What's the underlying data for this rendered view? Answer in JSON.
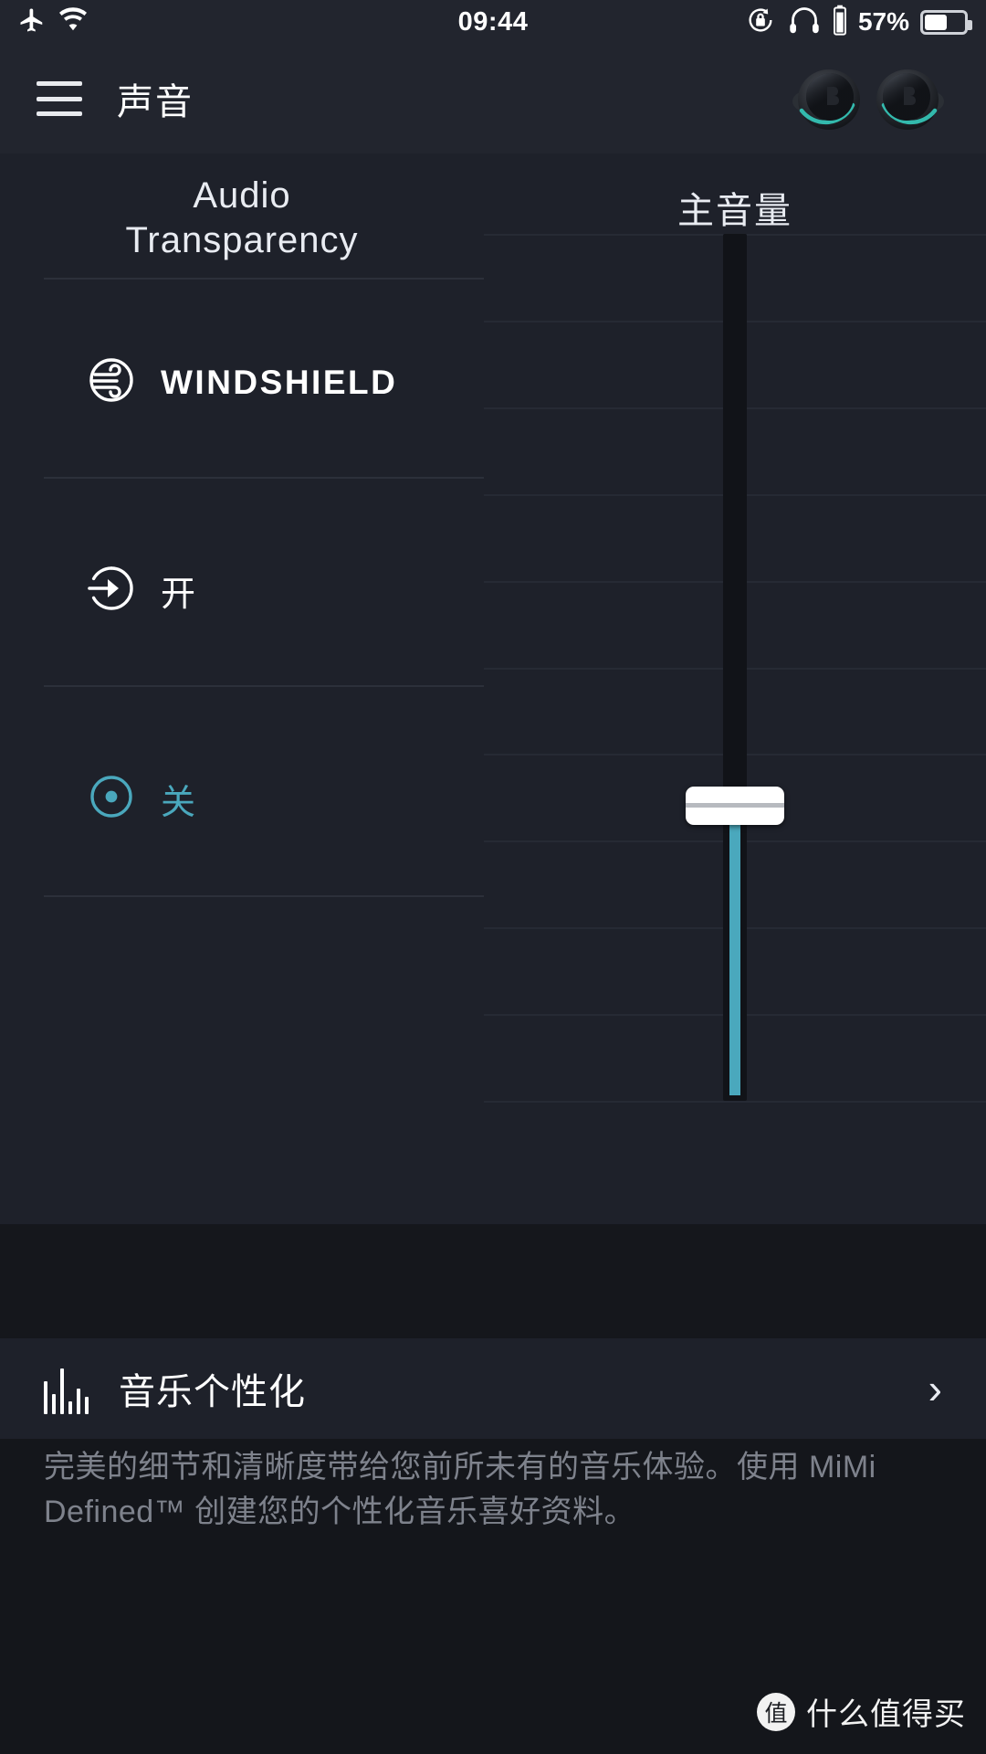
{
  "status_bar": {
    "airplane_icon": "airplane-mode-icon",
    "wifi_icon": "wifi-icon",
    "time": "09:44",
    "rotation_lock_icon": "rotation-lock-icon",
    "headphones_icon": "headphones-icon",
    "battery_small_icon": "battery-vertical-icon",
    "battery_percent": "57%",
    "battery_level": 57
  },
  "header": {
    "menu_icon": "hamburger-menu-icon",
    "title": "声音",
    "earbud_left_icon": "earbud-left-icon",
    "earbud_right_icon": "earbud-right-icon"
  },
  "audio_transparency": {
    "title_line1": "Audio",
    "title_line2": "Transparency",
    "options": [
      {
        "label": "WINDSHIELD",
        "icon": "wind-circle-icon",
        "selected": false,
        "style": "latin"
      },
      {
        "label": "开",
        "icon": "arrow-into-circle-icon",
        "selected": false,
        "style": "cjk"
      },
      {
        "label": "关",
        "icon": "radio-dot-icon",
        "selected": true,
        "style": "cjk"
      }
    ]
  },
  "volume": {
    "title": "主音量",
    "value_percent": 34,
    "gridline_count": 11
  },
  "music_personalization": {
    "icon": "equalizer-bars-icon",
    "title": "音乐个性化",
    "chevron_icon": "chevron-right-icon",
    "description": "完美的细节和清晰度带给您前所未有的音乐体验。使用 MiMi Defined™ 创建您的个性化音乐喜好资料。"
  },
  "watermark": {
    "logo_char": "值",
    "text": "什么值得买"
  },
  "colors": {
    "accent": "#4aa8bd",
    "page_bg": "#1e212a",
    "bar_bg": "#22252e",
    "band_bg": "#15171c",
    "text_primary": "#ffffff",
    "text_muted": "#7e828c"
  }
}
